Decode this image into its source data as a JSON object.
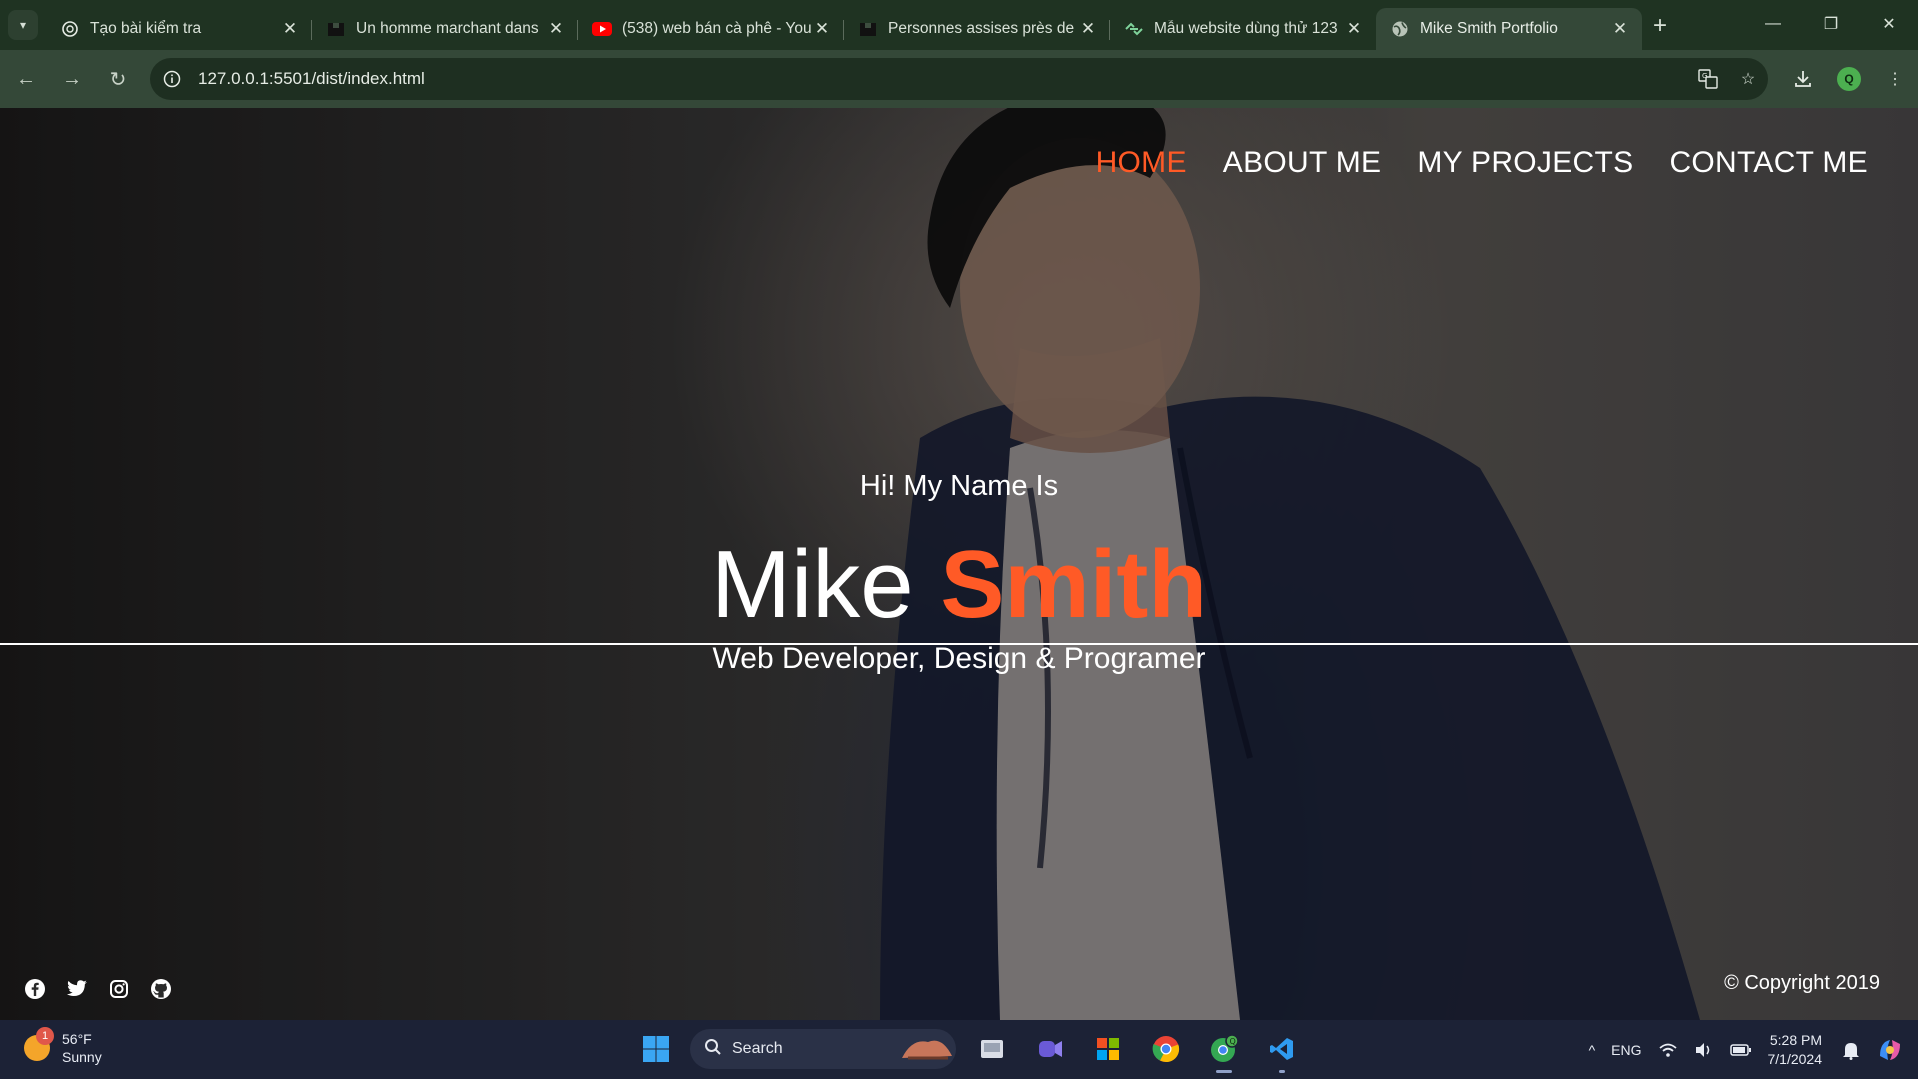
{
  "browser": {
    "tabs": [
      {
        "title": "Tạo bài kiểm tra",
        "favicon": "openai-icon",
        "active": false
      },
      {
        "title": "Un homme marchant dans",
        "favicon": "unsplash-icon",
        "active": false
      },
      {
        "title": "(538) web bán cà phê - You",
        "favicon": "youtube-icon",
        "active": false
      },
      {
        "title": "Personnes assises près de l",
        "favicon": "unsplash-icon",
        "active": false
      },
      {
        "title": "Mẫu website dùng thử 123",
        "favicon": "link-icon",
        "active": false
      },
      {
        "title": "Mike Smith Portfolio",
        "favicon": "globe-icon",
        "active": true
      }
    ],
    "url": "127.0.0.1:5501/dist/index.html",
    "profile_initial": "Q"
  },
  "page": {
    "nav": [
      "HOME",
      "ABOUT ME",
      "MY PROJECTS",
      "CONTACT ME"
    ],
    "active_nav": "HOME",
    "greeting": "Hi! My Name Is",
    "first_name": "Mike",
    "last_name": "Smith",
    "role": "Web Developer, Design & Programer",
    "copyright": "© Copyright 2019",
    "socials": [
      "facebook-icon",
      "twitter-icon",
      "instagram-icon",
      "github-icon"
    ],
    "accent_color": "#ff5a26"
  },
  "taskbar": {
    "weather_temp": "56°F",
    "weather_desc": "Sunny",
    "weather_badge": "1",
    "search_label": "Search",
    "chrome_badge": "Q",
    "language": "ENG",
    "time": "5:28 PM",
    "date": "7/1/2024"
  }
}
